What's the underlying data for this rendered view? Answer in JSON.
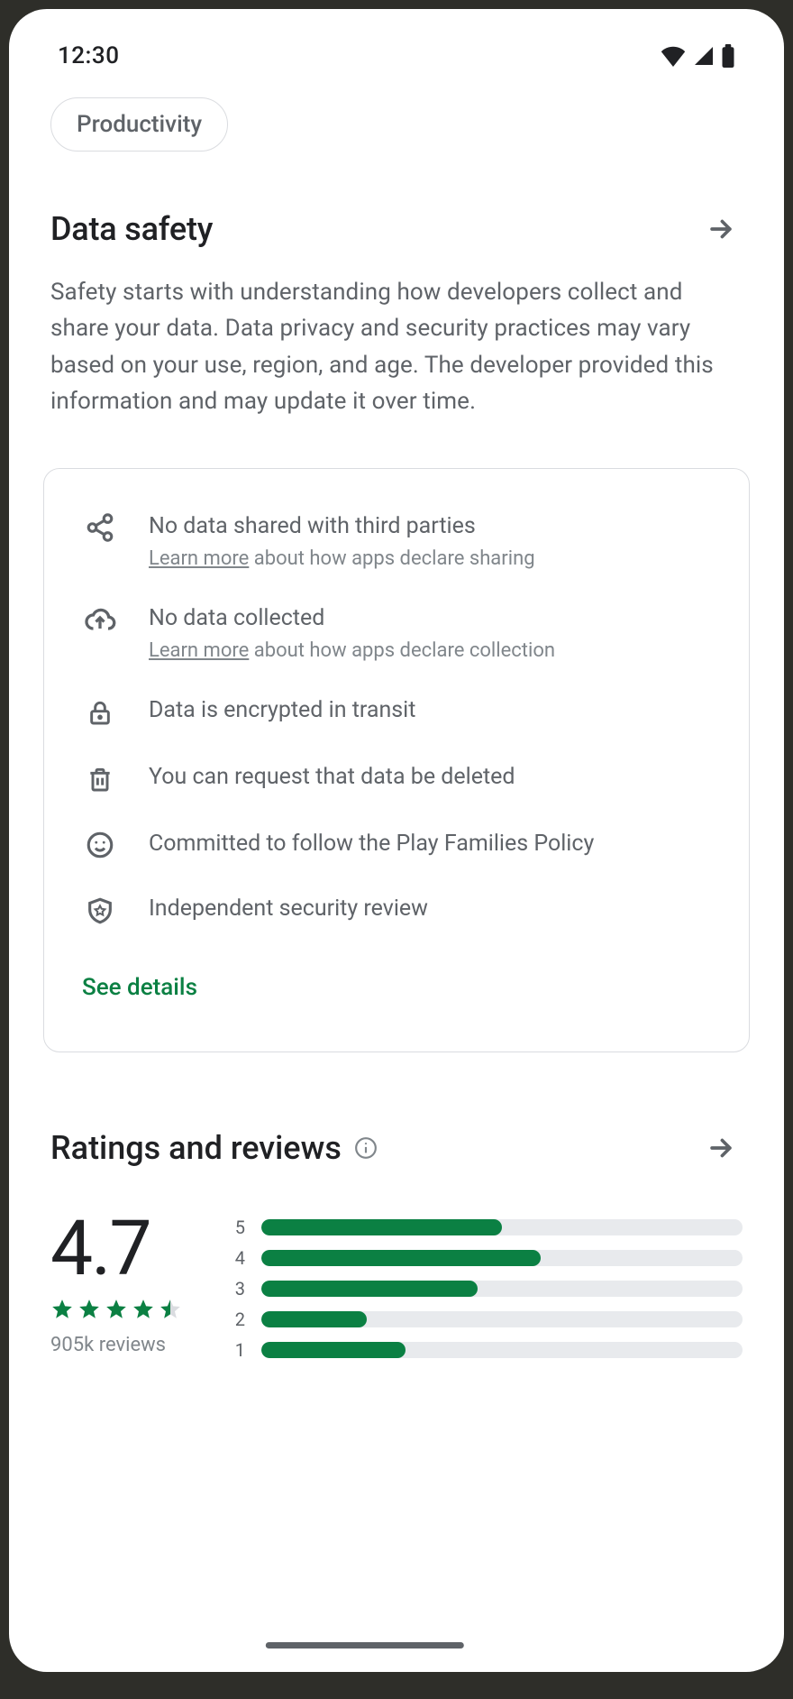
{
  "status": {
    "time": "12:30"
  },
  "chip": {
    "label": "Productivity"
  },
  "data_safety": {
    "title": "Data safety",
    "description": "Safety starts with understanding how developers collect and share your data. Data privacy and security practices may vary based on your use, region, and age. The developer provided this information and may update it over time.",
    "rows": [
      {
        "text": "No data shared with third parties",
        "learn_more": "Learn more",
        "sub_rest": " about how apps declare sharing"
      },
      {
        "text": "No data collected",
        "learn_more": "Learn more",
        "sub_rest": " about how apps declare collection"
      },
      {
        "text": "Data is encrypted in transit"
      },
      {
        "text": "You can request that data be deleted"
      },
      {
        "text": "Committed to follow the Play Families Policy"
      },
      {
        "text": "Independent security review"
      }
    ],
    "see_details": "See details"
  },
  "ratings": {
    "title": "Ratings and reviews",
    "score": "4.7",
    "review_count": "905k  reviews",
    "bars": [
      {
        "label": "5",
        "pct": 50
      },
      {
        "label": "4",
        "pct": 58
      },
      {
        "label": "3",
        "pct": 45
      },
      {
        "label": "2",
        "pct": 22
      },
      {
        "label": "1",
        "pct": 30
      }
    ]
  },
  "chart_data": {
    "type": "bar",
    "title": "Ratings and reviews",
    "categories": [
      "5",
      "4",
      "3",
      "2",
      "1"
    ],
    "values": [
      50,
      58,
      45,
      22,
      30
    ],
    "xlabel": "",
    "ylabel": "",
    "ylim": [
      0,
      100
    ],
    "aggregate_score": 4.7,
    "review_count": "905k"
  },
  "colors": {
    "accent": "#0b8043",
    "text_secondary": "#5f6368",
    "border": "#dadce0"
  }
}
